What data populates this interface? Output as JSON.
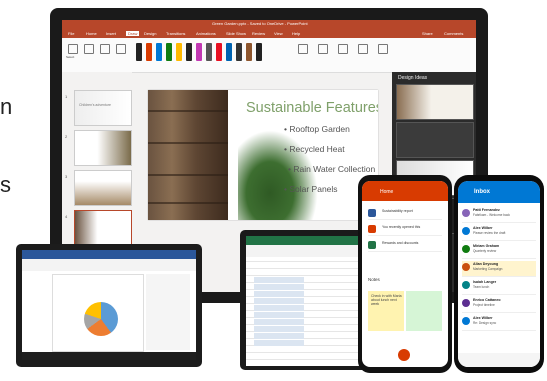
{
  "edge_text": {
    "char1": "n",
    "char2": "s"
  },
  "powerpoint": {
    "window_title": "Green Garden.pptx - Saved to OneDrive - PowerPoint",
    "tabs": [
      "File",
      "Home",
      "Insert",
      "Draw",
      "Design",
      "Transitions",
      "Animations",
      "Slide Show",
      "Review",
      "View",
      "Help"
    ],
    "share_label": "Share",
    "comments_label": "Comments",
    "ribbon_tools": [
      "Select",
      "Draw with Touch",
      "Lasso Select",
      "Eraser",
      "Add Pen",
      "Ruler",
      "Ink to Shape",
      "Ink to Math",
      "Replay"
    ],
    "slide": {
      "heading": "Sustainable Features",
      "bullets": [
        "Rooftop Garden",
        "Recycled Heat",
        "Rain Water Collection",
        "Solar Panels"
      ]
    },
    "design_pane": {
      "title": "Design Ideas"
    },
    "thumbnails": [
      "1",
      "2",
      "3",
      "4",
      "5"
    ],
    "thumb1_caption": "Children's adventure"
  },
  "office_mobile": {
    "app_title": "Home",
    "recent_items": [
      "Sustainability report",
      "You recently opened this",
      "Rewards and discounts"
    ],
    "notes_label": "Notes",
    "note_text": "Check in with Maria about lunch next week"
  },
  "outlook_mobile": {
    "inbox_label": "Inbox",
    "mails": [
      {
        "name": "Patti Fernandez",
        "subject": "Fabrikam - Welcome back"
      },
      {
        "name": "Alex Wilber",
        "subject": "Please review the draft"
      },
      {
        "name": "Miriam Graham",
        "subject": "Quarterly review"
      },
      {
        "name": "Allan Deyoung",
        "subject": "Marketing Campaign"
      },
      {
        "name": "Isaiah Langer",
        "subject": "Team lunch"
      },
      {
        "name": "Enrico Cattaneo",
        "subject": "Project timeline"
      },
      {
        "name": "Alex Wilber",
        "subject": "Re: Design sync"
      }
    ]
  },
  "colors": {
    "powerpoint": "#b7472a",
    "word": "#2b579a",
    "excel": "#217346",
    "office_mobile": "#d83b01",
    "outlook": "#0078d4",
    "slide_heading": "#7fa06a"
  }
}
